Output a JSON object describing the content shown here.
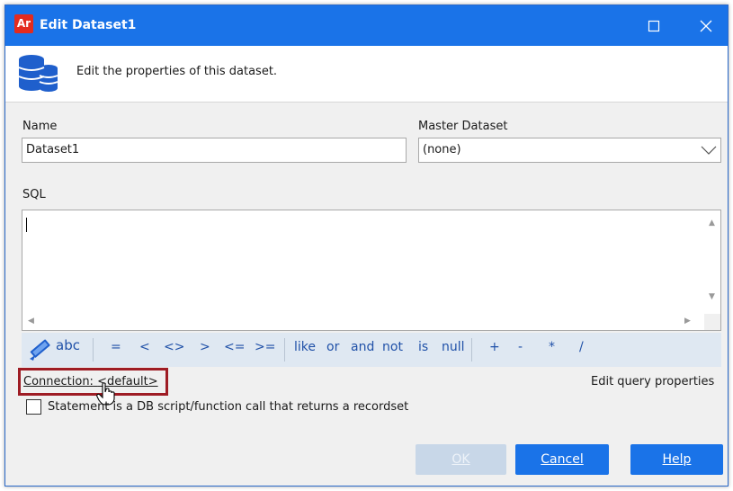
{
  "window": {
    "app_icon_text": "Ar",
    "title": "Edit Dataset1"
  },
  "header": {
    "description": "Edit the properties of this dataset."
  },
  "form": {
    "name_label": "Name",
    "name_value": "Dataset1",
    "master_label": "Master Dataset",
    "master_value": "(none)",
    "sql_label": "SQL",
    "sql_value": ""
  },
  "toolbar": {
    "operators": [
      "=",
      "<",
      "<>",
      ">",
      "<=",
      ">="
    ],
    "keywords": [
      "like",
      "or",
      "and",
      "not",
      "is",
      "null"
    ],
    "arithmetic": [
      "+",
      "-",
      "*",
      "/"
    ],
    "spell_icon_text": "abc"
  },
  "connection": {
    "label": "Connection:",
    "value": "<default>"
  },
  "edit_query_properties": "Edit query properties",
  "statement_checkbox": {
    "label": "Statement is a DB script/function call that returns a recordset",
    "checked": false
  },
  "buttons": {
    "ok": "OK",
    "cancel": "Cancel",
    "help": "Help"
  },
  "colors": {
    "titlebar": "#1a73e8",
    "accent_button": "#1a73e8",
    "disabled_button": "#c8d7e8",
    "highlight_box": "#9e1c24",
    "toolbar_bg": "#dfe8f2"
  }
}
